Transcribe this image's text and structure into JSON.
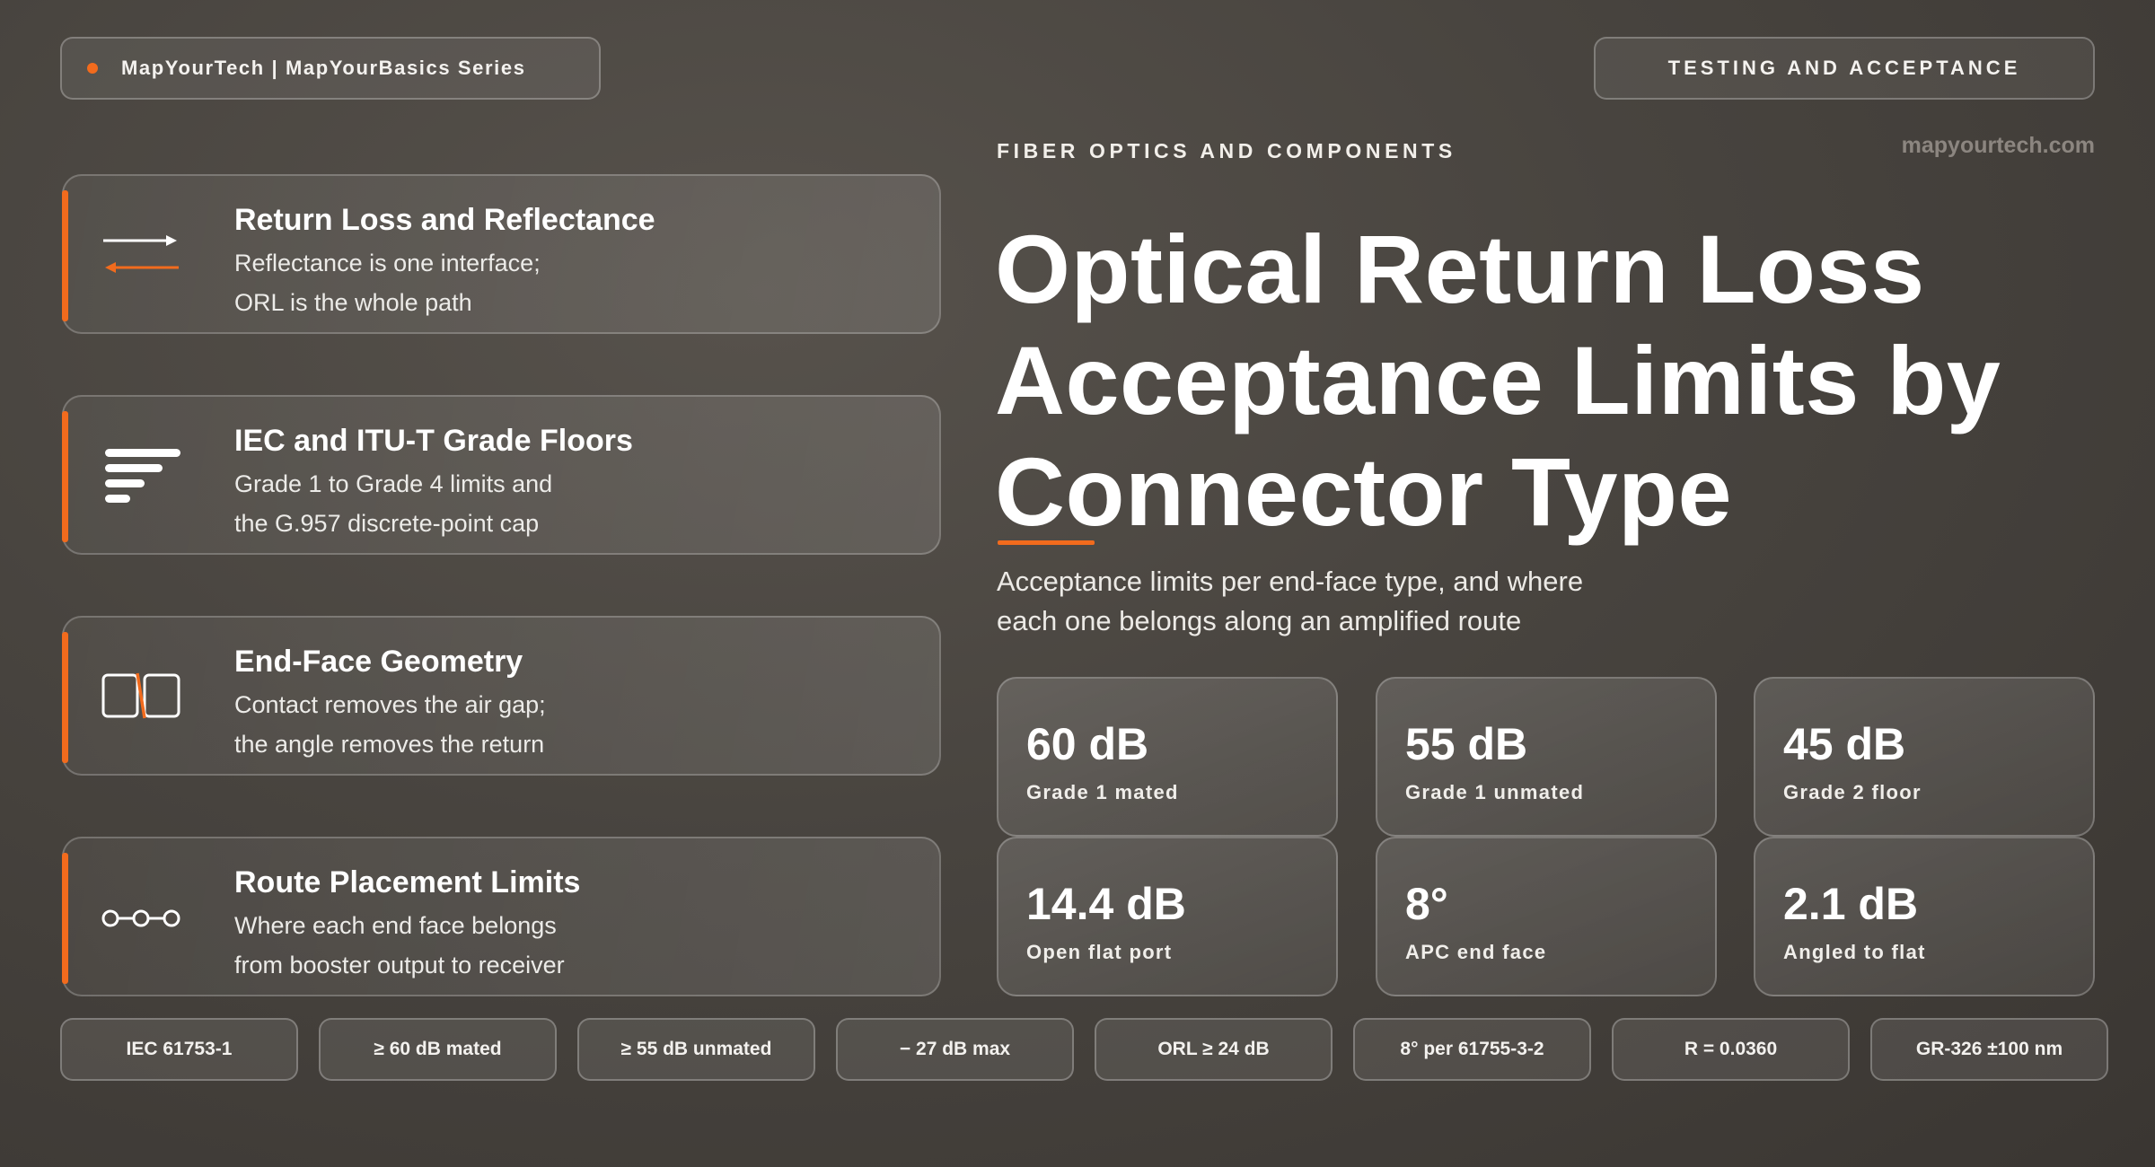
{
  "header": {
    "brand": "MapYourTech | MapYourBasics Series",
    "topic": "TESTING AND ACCEPTANCE",
    "category": "FIBER OPTICS AND COMPONENTS",
    "site": "mapyourtech.com"
  },
  "hero": {
    "title_lines": [
      "Optical Return Loss",
      "Acceptance Limits by",
      "Connector Type"
    ],
    "subtitle_lines": [
      "Acceptance limits per end-face type, and where",
      "each one belongs along an amplified route"
    ]
  },
  "cards": [
    {
      "icon": "arrows-icon",
      "title": "Return Loss and Reflectance",
      "line1": "Reflectance is one interface;",
      "line2": "ORL is the whole path"
    },
    {
      "icon": "bars-icon",
      "title": "IEC and ITU-T Grade Floors",
      "line1": "Grade 1 to Grade 4 limits and",
      "line2": "the G.957 discrete-point cap"
    },
    {
      "icon": "end-face-icon",
      "title": "End-Face Geometry",
      "line1": "Contact removes the air gap;",
      "line2": "the angle removes the return"
    },
    {
      "icon": "route-nodes-icon",
      "title": "Route Placement Limits",
      "line1": "Where each end face belongs",
      "line2": "from booster output to receiver"
    }
  ],
  "stats": [
    {
      "value": "60 dB",
      "label": "Grade 1 mated"
    },
    {
      "value": "55 dB",
      "label": "Grade 1 unmated"
    },
    {
      "value": "45 dB",
      "label": "Grade 2 floor"
    },
    {
      "value": "14.4 dB",
      "label": "Open flat port"
    },
    {
      "value": "8°",
      "label": "APC end face"
    },
    {
      "value": "2.1 dB",
      "label": "Angled to flat"
    }
  ],
  "chips": [
    "IEC 61753-1",
    "≥ 60 dB mated",
    "≥ 55 dB unmated",
    "− 27 dB max",
    "ORL ≥ 24 dB",
    "8° per 61755-3-2",
    "R = 0.0360",
    "GR-326 ±100 nm"
  ],
  "colors": {
    "accent": "#f26b1d",
    "background": "#48443f",
    "text": "#ffffff"
  }
}
